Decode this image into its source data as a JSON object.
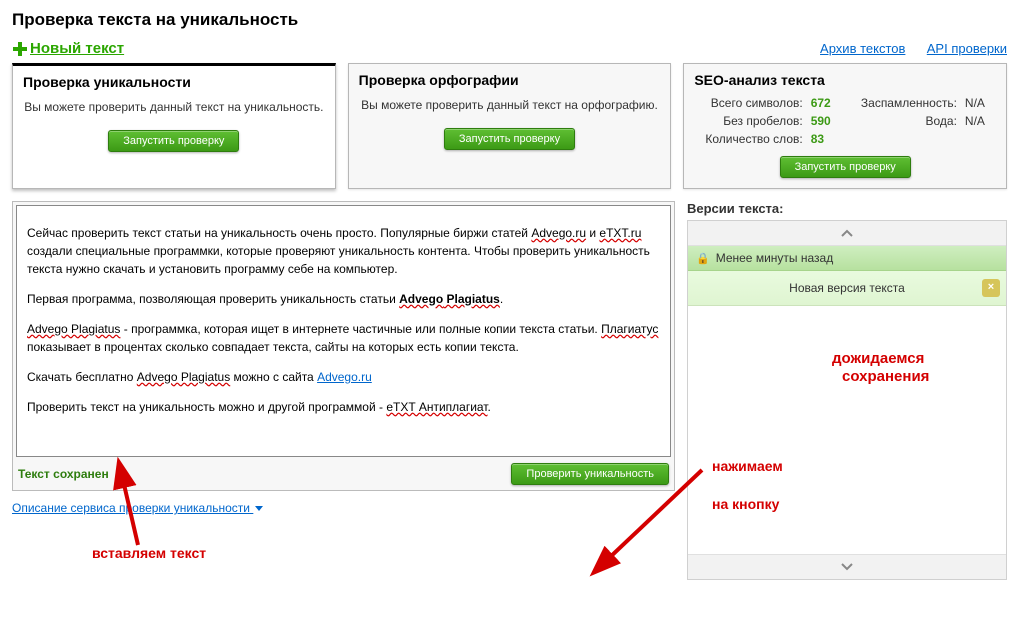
{
  "page_title": "Проверка текста на уникальность",
  "new_text_label": "Новый текст",
  "top_links": {
    "archive": "Архив текстов",
    "api": "API проверки"
  },
  "tabs": {
    "uniqueness": {
      "title": "Проверка уникальности",
      "desc": "Вы можете проверить данный текст на уникальность.",
      "button": "Запустить проверку"
    },
    "spelling": {
      "title": "Проверка орфографии",
      "desc": "Вы можете проверить данный текст на орфографию.",
      "button": "Запустить проверку"
    },
    "seo": {
      "title": "SEO-анализ текста",
      "stats": {
        "total_chars_label": "Всего символов:",
        "total_chars": "672",
        "no_spaces_label": "Без пробелов:",
        "no_spaces": "590",
        "words_label": "Количество слов:",
        "words": "83",
        "spam_label": "Заспамленность:",
        "spam": "N/A",
        "water_label": "Вода:",
        "water": "N/A"
      },
      "button": "Запустить проверку"
    }
  },
  "editor": {
    "p1_a": "Сейчас проверить текст статьи на уникальность очень просто.  Популярные биржи статей ",
    "p1_advego": "Advego.ru",
    "p1_b": "  и ",
    "p1_etxt": "eTXT.ru",
    "p1_c": " создали специальные программки, которые проверяют уникальность контента. Чтобы проверить уникальность текста нужно скачать и установить программу себе на компьютер.",
    "p2_a": "Первая программа, позволяющая проверить уникальность статьи ",
    "p2_b_bold": "Advego",
    "p2_b_err": " Plagiatus",
    "p2_c": ".",
    "p3_link": "Advego Plagiatus",
    "p3_a": " - программка, которая ищет  в интернете частичные или полные копии текста статьи. ",
    "p3_err": "Плагиатус",
    "p3_b": " показывает в процентах сколько совпадает текста, сайты на которых есть копии текста.",
    "p4_a": "Скачать бесплатно ",
    "p4_err": "Advego Plagiatus",
    "p4_b": " можно с сайта ",
    "p4_link": "Advego.ru",
    "p5_a": "Проверить текст на уникальность можно и другой программой - ",
    "p5_err": "eTXT Антиплагиат",
    "p5_b": "."
  },
  "editor_foot": {
    "saved": "Текст сохранен",
    "check_btn": "Проверить уникальность"
  },
  "versions": {
    "title": "Версии текста:",
    "item_time": "Менее минуты назад",
    "item_title": "Новая версия текста",
    "close": "×"
  },
  "annotations": {
    "insert_text": "вставляем текст",
    "press_button_1": "нажимаем",
    "press_button_2": "на кнопку",
    "wait_save_1": "дожидаемся",
    "wait_save_2": "сохранения"
  },
  "footer_link": "Описание сервиса проверки уникальности"
}
